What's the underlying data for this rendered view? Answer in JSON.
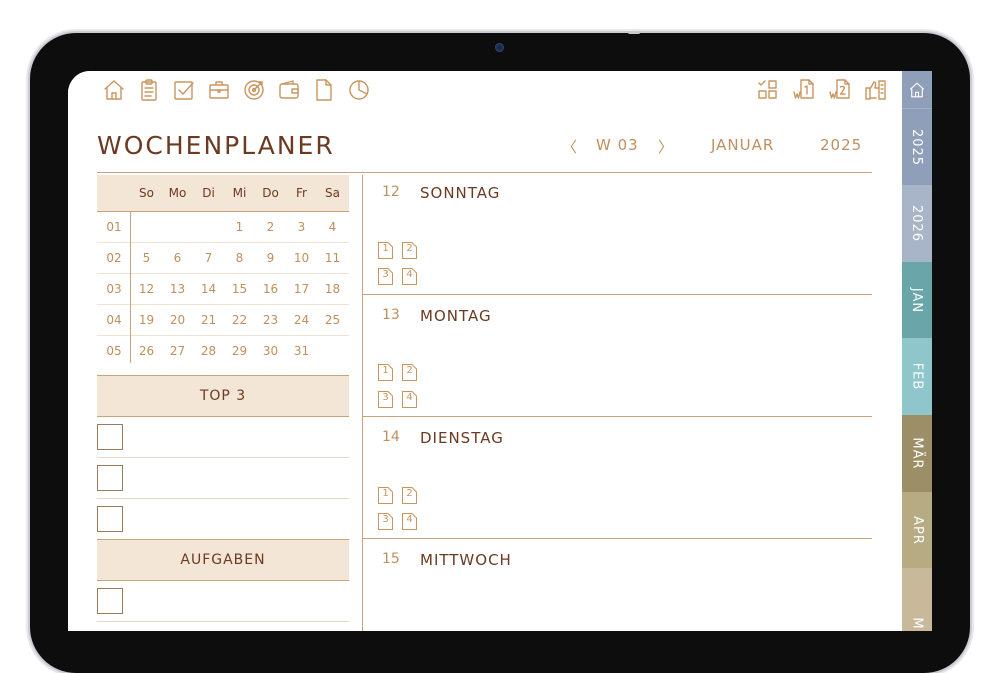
{
  "app": {
    "title": "WOCHENPLANER"
  },
  "toolbar": {
    "left_icons": [
      "home-icon",
      "clipboard-icon",
      "checkbox-icon",
      "briefcase-icon",
      "target-icon",
      "wallet-icon",
      "document-icon",
      "pie-chart-icon"
    ],
    "right_icons": [
      "checklist-grid-icon",
      "week-one-icon",
      "week-two-icon",
      "thumbs-up-list-icon"
    ],
    "right_labels": {
      "w1": "1",
      "w2": "2",
      "wprefix": "w"
    }
  },
  "nav": {
    "prev": "〈",
    "week": "W 03",
    "next": "〉",
    "month": "JANUAR",
    "year": "2025"
  },
  "calendar": {
    "headers": [
      "So",
      "Mo",
      "Di",
      "Mi",
      "Do",
      "Fr",
      "Sa"
    ],
    "weeks": [
      {
        "wk": "01",
        "days": [
          "",
          "",
          "",
          "1",
          "2",
          "3",
          "4"
        ]
      },
      {
        "wk": "02",
        "days": [
          "5",
          "6",
          "7",
          "8",
          "9",
          "10",
          "11"
        ]
      },
      {
        "wk": "03",
        "days": [
          "12",
          "13",
          "14",
          "15",
          "16",
          "17",
          "18"
        ]
      },
      {
        "wk": "04",
        "days": [
          "19",
          "20",
          "21",
          "22",
          "23",
          "24",
          "25"
        ]
      },
      {
        "wk": "05",
        "days": [
          "26",
          "27",
          "28",
          "29",
          "30",
          "31",
          ""
        ]
      }
    ]
  },
  "top3": {
    "title": "TOP 3"
  },
  "tasks": {
    "title": "AUFGABEN"
  },
  "days": [
    {
      "num": "12",
      "name": "SONNTAG"
    },
    {
      "num": "13",
      "name": "MONTAG"
    },
    {
      "num": "14",
      "name": "DIENSTAG"
    },
    {
      "num": "15",
      "name": "MITTWOCH"
    }
  ],
  "quadrants": [
    "1",
    "2",
    "3",
    "4"
  ],
  "tabs": [
    {
      "label": "",
      "icon": "home-icon",
      "color": "#8f9fba"
    },
    {
      "label": "2025",
      "color": "#8f9fba"
    },
    {
      "label": "2026",
      "color": "#a8b4c8"
    },
    {
      "label": "JAN",
      "color": "#6aa5aa"
    },
    {
      "label": "FEB",
      "color": "#8fc6cb"
    },
    {
      "label": "MÄR",
      "color": "#9c8f67"
    },
    {
      "label": "APR",
      "color": "#b6ab83"
    },
    {
      "label": "M",
      "color": "#c7b99a"
    }
  ],
  "colors": {
    "accent": "#c9955f",
    "text_dark": "#6b3a21",
    "header_bg": "#f3e6d6"
  }
}
